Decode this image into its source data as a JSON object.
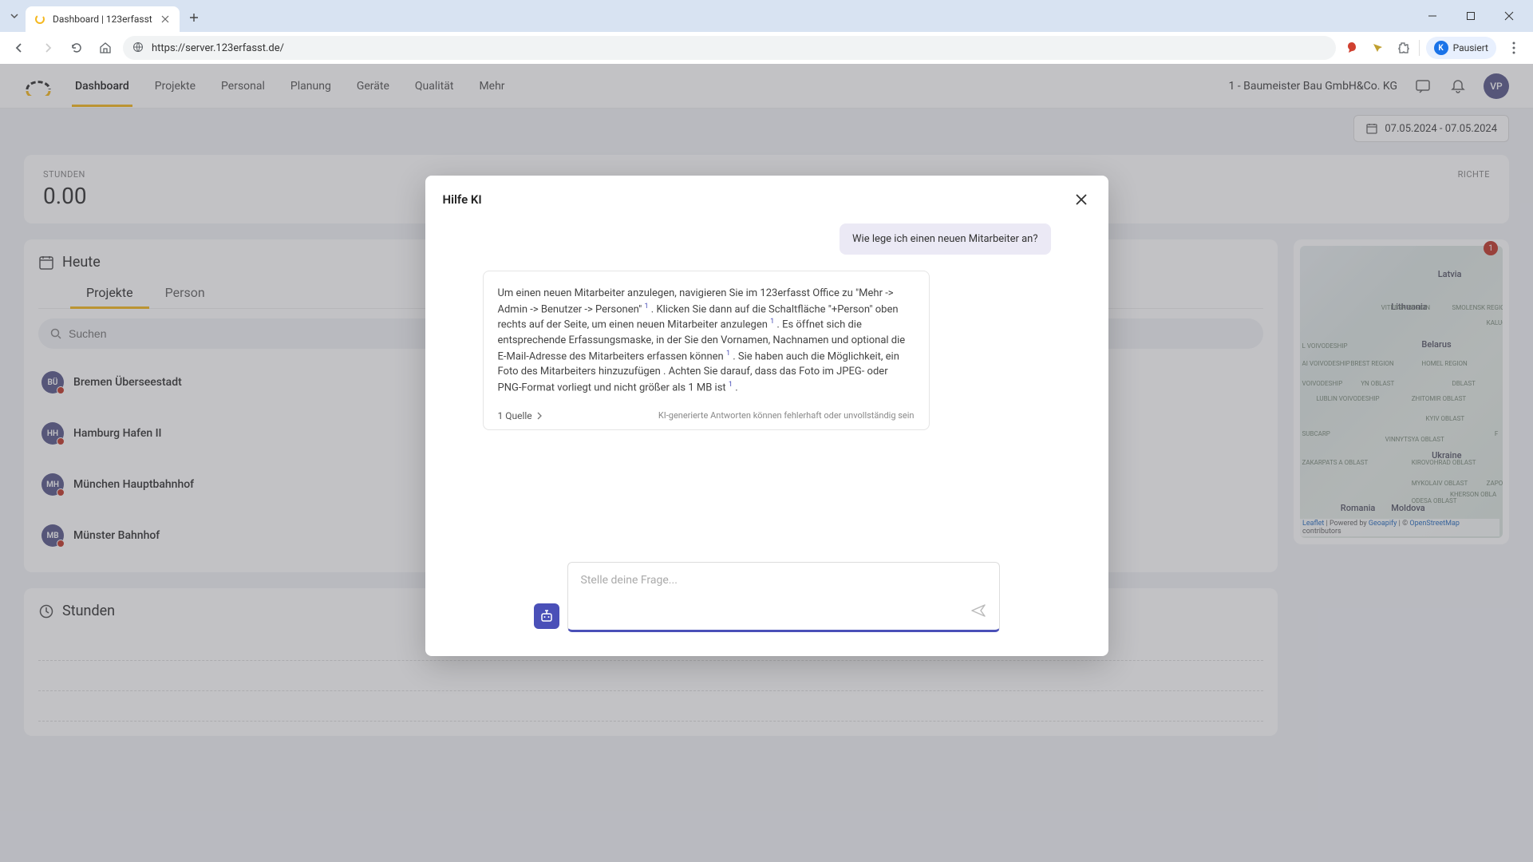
{
  "browser": {
    "tab_title": "Dashboard | 123erfasst",
    "url": "https://server.123erfasst.de/",
    "profile_initial": "K",
    "profile_status": "Pausiert"
  },
  "nav": {
    "items": [
      "Dashboard",
      "Projekte",
      "Personal",
      "Planung",
      "Geräte",
      "Qualität",
      "Mehr"
    ],
    "company": "1 - Baumeister Bau GmbH&Co. KG",
    "user_initials": "VP"
  },
  "date_range": "07.05.2024 - 07.05.2024",
  "stats": {
    "hours_label": "STUNDEN",
    "hours_value": "0.00",
    "reports_label": "RICHTE"
  },
  "today": {
    "title": "Heute",
    "tabs": [
      "Projekte",
      "Person"
    ],
    "search_placeholder": "Suchen",
    "projects": [
      {
        "initials": "BÜ",
        "name": "Bremen Überseestadt",
        "color": "#5a5a8a"
      },
      {
        "initials": "HH",
        "name": "Hamburg Hafen II",
        "color": "#5a5a8a"
      },
      {
        "initials": "MH",
        "name": "München Hauptbahnhof",
        "color": "#5a5a8a"
      },
      {
        "initials": "MB",
        "name": "Münster Bahnhof",
        "color": "#5a5a8a"
      }
    ]
  },
  "map": {
    "badge": "1",
    "countries": {
      "c1": "Latvia",
      "c2": "Lithuania",
      "c3": "Belarus",
      "c4": "Ukraine",
      "c5": "Romania",
      "c6": "Moldova"
    },
    "regions": {
      "r1": "VITEBSK REGION",
      "r2": "SMOLENSK REGION",
      "r3": "KALUG",
      "r4": "L VOIVODESHIP",
      "r5": "AI VOIVODESHIP",
      "r6": "BREST REGION",
      "r7": "HOMEL REGION",
      "r8": "VOIVODESHIP",
      "r9": "YN OBLAST",
      "r10": "DBLAST",
      "r11": "LUBLIN VOIVODESHIP",
      "r12": "ZHITOMIR OBLAST",
      "r13": "KYIV OBLAST",
      "r14": "SUBCARP",
      "r15": "VINNYTSYA OBLAST",
      "r16": "F",
      "r17": "ZAKARPATS A OBLAST",
      "r18": "KIROVOHRAD OBLAST",
      "r19": "MYKOLAIV OBLAST",
      "r20": "ZAPO",
      "r21": "ODESA OBLAST",
      "r22": "KHERSON OBLA"
    },
    "attribution": {
      "leaflet": "Leaflet",
      "sep1": " | Powered by ",
      "geoapify": "Geoapify",
      "sep2": " | © ",
      "osm": "OpenStreetMap",
      "contrib": " contributors"
    }
  },
  "hours_section": {
    "title": "Stunden"
  },
  "modal": {
    "title": "Hilfe KI",
    "user_message": "Wie lege ich einen neuen Mitarbeiter an?",
    "response_parts": {
      "p1": "Um einen neuen Mitarbeiter anzulegen, navigieren Sie im 123erfasst Office zu \"Mehr -> Admin -> Benutzer -> Personen\" ",
      "p2": " . Klicken Sie dann auf die Schaltfläche \"+Person\" oben rechts auf der Seite, um einen neuen Mitarbeiter anzulegen ",
      "p3": " . Es öffnet sich die entsprechende Erfassungsmaske, in der Sie den Vornamen, Nachnamen und optional die E-Mail-Adresse des Mitarbeiters erfassen können ",
      "p4": " . Sie haben auch die Möglichkeit, ein Foto des Mitarbeiters hinzuzufügen . Achten Sie darauf, dass das Foto im JPEG- oder PNG-Format vorliegt und nicht größer als 1 MB ist ",
      "p5": " ."
    },
    "citation": "1",
    "source_count": "1 Quelle",
    "disclaimer": "KI-generierte Antworten können fehlerhaft oder unvollständig sein",
    "input_placeholder": "Stelle deine Frage..."
  }
}
